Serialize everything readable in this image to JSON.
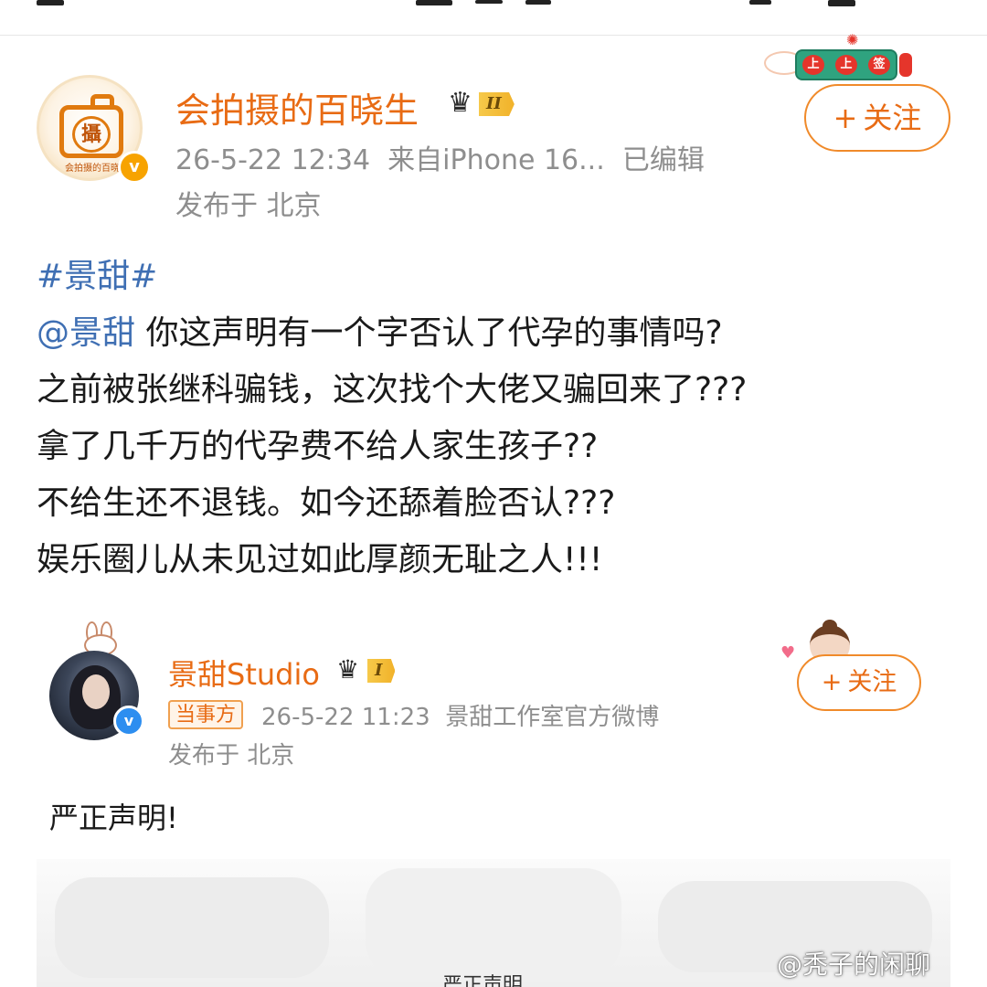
{
  "main_post": {
    "username": "会拍摄的百晓生",
    "member_level": "II",
    "time": "26-5-22 12:34",
    "source": "来自iPhone 16...",
    "edited": "已编辑",
    "location": "发布于 北京",
    "follow_label": "关注",
    "follow_plus": "+",
    "avatar_glyph": "攝",
    "avatar_caption": "会拍摄的百晓",
    "verified_mark": "v",
    "festive_badge": [
      "上",
      "上",
      "签"
    ],
    "hashtag": "#景甜#",
    "mention": "@景甜",
    "lines": [
      "你这声明有一个字否认了代孕的事情吗?",
      "之前被张继科骗钱，这次找个大佬又骗回来了???",
      "拿了几千万的代孕费不给人家生孩子??",
      "不给生还不退钱。如今还舔着脸否认???",
      "娱乐圈儿从未见过如此厚颜无耻之人!!!"
    ]
  },
  "repost": {
    "username": "景甜Studio",
    "member_level": "I",
    "party_tag": "当事方",
    "time": "26-5-22 11:23",
    "source": "景甜工作室官方微博",
    "location": "发布于 北京",
    "follow_label": "关注",
    "follow_plus": "+",
    "verified_mark": "v",
    "text": "严正声明!",
    "doc_title_partial": "严正声明"
  },
  "watermark": "@秃子的闲聊",
  "colors": {
    "orange_text": "#e86b14",
    "link_blue": "#3f6fb3",
    "meta_gray": "#8e8e8e"
  }
}
